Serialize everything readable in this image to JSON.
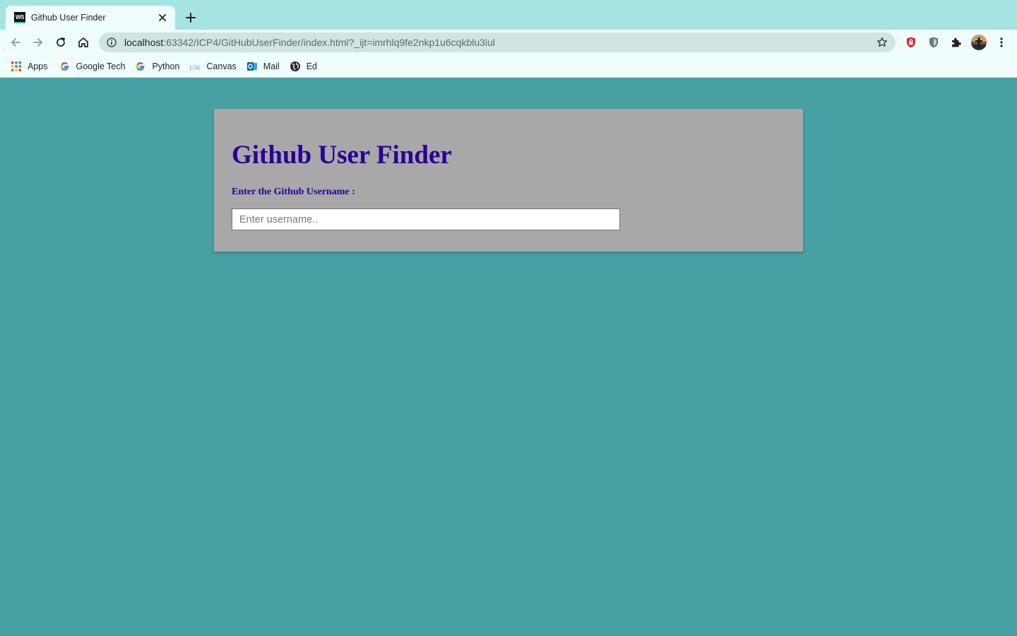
{
  "browser": {
    "tab": {
      "favicon_text": "WS",
      "title": "Github User Finder"
    },
    "omnibox": {
      "host": "localhost",
      "rest": ":63342/ICP4/GitHubUserFinder/index.html?_ijt=imrhlq9fe2nkp1u6cqkblu3iul"
    },
    "bookmarks": [
      {
        "label": "Apps",
        "icon": "apps-grid-icon"
      },
      {
        "label": "Google Tech",
        "icon": "google-icon"
      },
      {
        "label": "Python",
        "icon": "google-icon"
      },
      {
        "label": "Canvas",
        "icon": "unc-icon"
      },
      {
        "label": "Mail",
        "icon": "outlook-icon"
      },
      {
        "label": "Ed",
        "icon": "globe-icon"
      }
    ]
  },
  "page": {
    "title": "Github User Finder",
    "label": "Enter the Github Username :",
    "input_placeholder": "Enter username..",
    "input_value": ""
  },
  "colors": {
    "page_background": "#47a0a2",
    "card_background": "#a8a8a8",
    "heading_text": "#2a0097",
    "tabstrip": "#a6e3e3",
    "toolbar": "#effdfd"
  }
}
